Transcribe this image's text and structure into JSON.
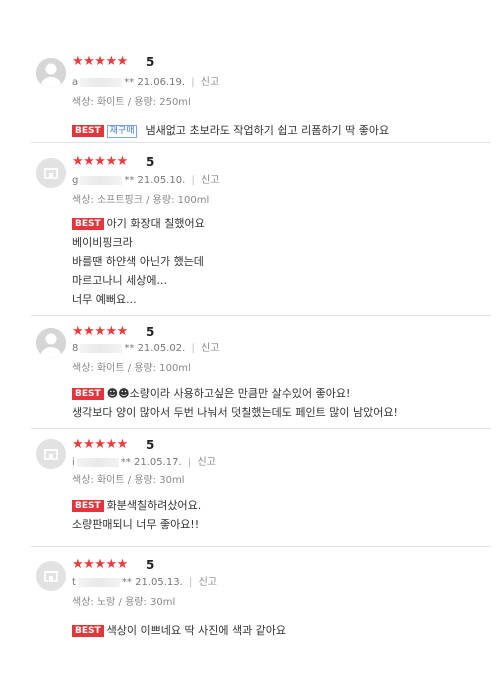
{
  "reviews": [
    {
      "avatar": "person-icon",
      "stars": "★★★★★",
      "score": "5",
      "user_prefix": "a",
      "user_mask": "**",
      "date": "21.06.19.",
      "sep": "|",
      "report": "신고",
      "option": "색상: 화이트 / 용량: 250ml",
      "best": "BEST",
      "repurchase": "재구매",
      "lines": [
        "냄새없고  초보라도 작업하기 쉽고  리폼하기 딱 좋아요"
      ]
    },
    {
      "avatar": "store-icon",
      "stars": "★★★★★",
      "score": "5",
      "user_prefix": "g",
      "user_mask": "**",
      "date": "21.05.10.",
      "sep": "|",
      "report": "신고",
      "option": "색상: 소프트핑크 / 용량: 100ml",
      "best": "BEST",
      "lines": [
        "아기 화장대 칠했어요",
        "베이비핑크라",
        "바를땐 하얀색 아닌가 했는데",
        "마르고나니 세상에...",
        "너무 예뻐요..."
      ]
    },
    {
      "avatar": "person-icon",
      "stars": "★★★★★",
      "score": "5",
      "user_prefix": "8",
      "user_mask": "**",
      "date": "21.05.02.",
      "sep": "|",
      "report": "신고",
      "option": "색상: 화이트 / 용량: 100ml",
      "best": "BEST",
      "lines": [
        "☻☻소량이라 사용하고싶은 만큼만 살수있어 좋아요!",
        "생각보다 양이 많아서 두번 나눠서 덧칠했는데도 페인트 많이 남았어요!"
      ]
    },
    {
      "avatar": "store-icon",
      "stars": "★★★★★",
      "score": "5",
      "user_prefix": "i",
      "user_mask": "**",
      "date": "21.05.17.",
      "sep": "|",
      "report": "신고",
      "option": "색상: 화이트 / 용량: 30ml",
      "best": "BEST",
      "lines": [
        "화분색칠하려샀어요.",
        "소량판매되니 너무 좋아요!!"
      ]
    },
    {
      "avatar": "store-icon",
      "stars": "★★★★★",
      "score": "5",
      "user_prefix": "t",
      "user_mask": "**",
      "date": "21.05.13.",
      "sep": "|",
      "report": "신고",
      "option": "색상: 노랑 / 용량: 30ml",
      "best": "BEST",
      "lines": [
        "색상이 이쁘네요 딱 사진에 색과 같아요"
      ]
    }
  ]
}
